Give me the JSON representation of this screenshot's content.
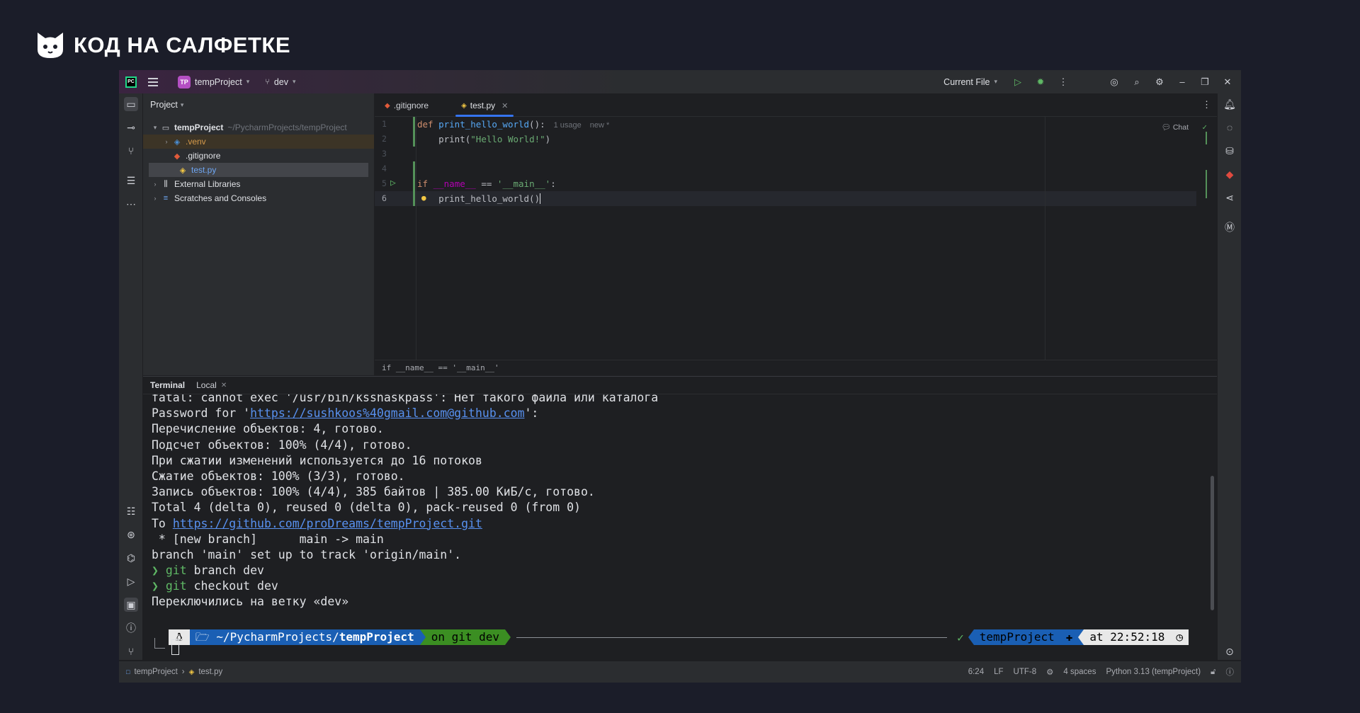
{
  "brand": {
    "name": "КОД НА САЛФЕТКЕ"
  },
  "titlebar": {
    "logo_text": "PC",
    "project_badge": "TP",
    "project_name": "tempProject",
    "branch": "dev",
    "run_config": "Current File"
  },
  "project_panel": {
    "header": "Project",
    "items": [
      {
        "label": "tempProject",
        "path": "~/PycharmProjects/tempProject"
      },
      {
        "label": ".venv"
      },
      {
        "label": ".gitignore"
      },
      {
        "label": "test.py"
      },
      {
        "label": "External Libraries"
      },
      {
        "label": "Scratches and Consoles"
      }
    ]
  },
  "editor": {
    "tabs": [
      {
        "label": ".gitignore"
      },
      {
        "label": "test.py"
      }
    ],
    "chat_label": "Chat",
    "line_numbers": [
      "1",
      "2",
      "3",
      "4",
      "5",
      "6"
    ],
    "lines": {
      "l1_kw": "def",
      "l1_fn": "print_hello_world",
      "l1_rest": "():",
      "l1_hint1": "1 usage",
      "l1_hint2": "new *",
      "l2_fn": "print",
      "l2_p1": "(",
      "l2_str": "\"Hello World!\"",
      "l2_p2": ")",
      "l5_kw": "if",
      "l5_sp": "__name__",
      "l5_op": " == ",
      "l5_str": "'__main__'",
      "l5_colon": ":",
      "l6_code": "print_hello_world()"
    },
    "breadcrumb": "if __name__ == '__main__'"
  },
  "terminal": {
    "title": "Terminal",
    "tab_local": "Local",
    "lines": [
      "fatal: cannot exec '/usr/bin/ksshaskpass': Нет такого файла или каталога",
      "Перечисление объектов: 4, готово.",
      "Подсчет объектов: 100% (4/4), готово.",
      "При сжатии изменений используется до 16 потоков",
      "Сжатие объектов: 100% (3/3), готово.",
      "Запись объектов: 100% (4/4), 385 байтов | 385.00 КиБ/с, готово.",
      "Total 4 (delta 0), reused 0 (delta 0), pack-reused 0 (from 0)",
      " * [new branch]      main -> main",
      "branch 'main' set up to track 'origin/main'.",
      "Переключились на ветку «dev»"
    ],
    "password_prefix": "Password for '",
    "password_link": "https://sushkoos%40gmail.com@github.com",
    "password_suffix": "':",
    "to_prefix": "To ",
    "to_link": "https://github.com/proDreams/tempProject.git",
    "cmd1": "git branch dev",
    "cmd2": "git checkout dev",
    "prompt_symbol": "❯",
    "prompt": {
      "path_prefix": "~/PycharmProjects/",
      "path_bold": "tempProject",
      "git": "on git dev",
      "ok": "✓",
      "venv": "tempProject",
      "time": "at 22:52:18"
    }
  },
  "statusbar": {
    "crumb1": "tempProject",
    "crumb2": "test.py",
    "position": "6:24",
    "line_sep": "LF",
    "encoding": "UTF-8",
    "indent": "4 spaces",
    "interpreter": "Python 3.13 (tempProject)"
  }
}
